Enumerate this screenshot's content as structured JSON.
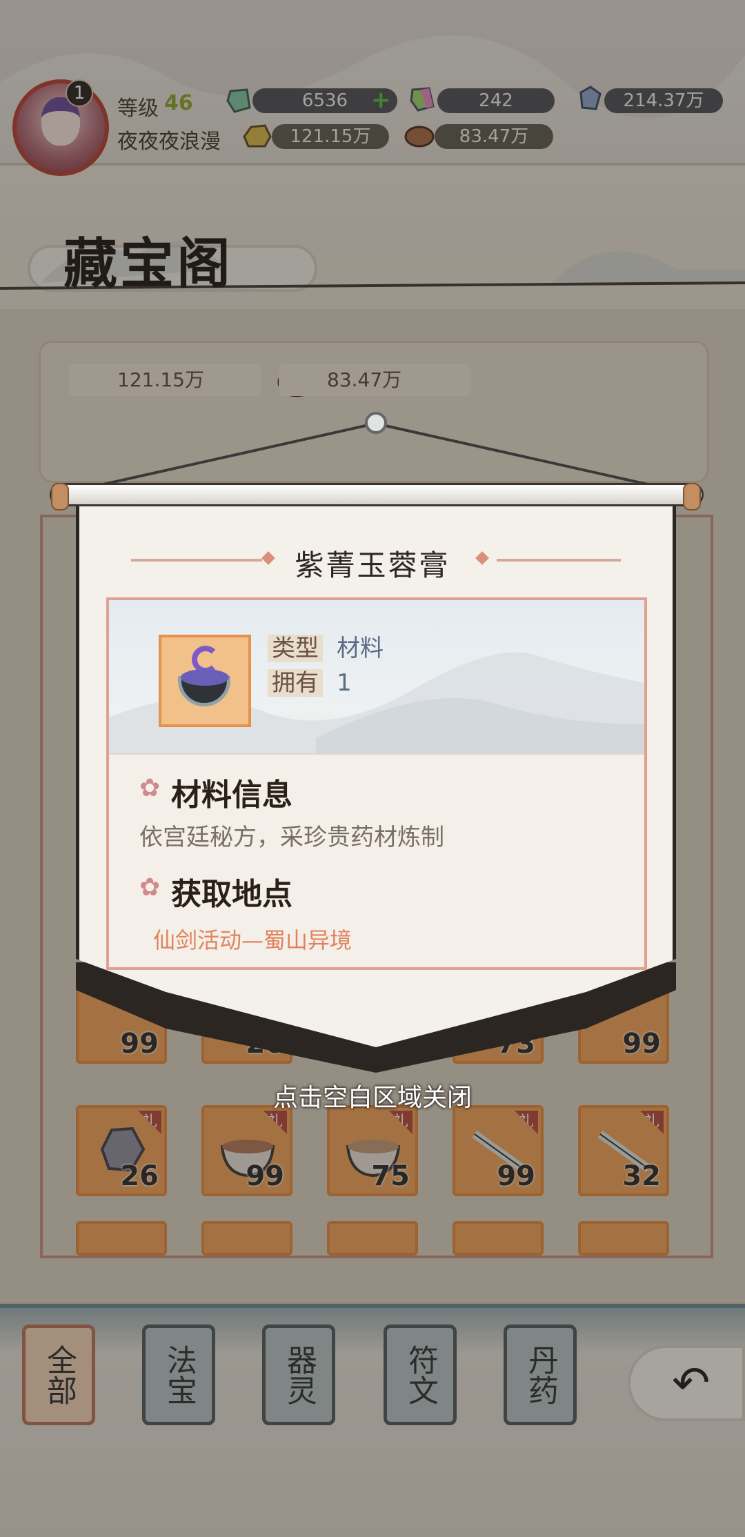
{
  "player": {
    "level_label": "等级",
    "level": "46",
    "name": "夜夜夜浪漫",
    "avatar_badge": "1"
  },
  "currencies": {
    "gem_green": "6536",
    "gem_rainbow": "242",
    "crystal": "214.37万",
    "gold_ore": "121.15万",
    "wood": "83.47万"
  },
  "header": {
    "title": "藏宝阁"
  },
  "panel_resources": {
    "gold_ore": "121.15万",
    "wood": "83.47万"
  },
  "grid": {
    "rows": [
      {
        "counts": [
          "99",
          "26",
          "",
          "73",
          "99"
        ]
      },
      {
        "counts": [
          "26",
          "99",
          "75",
          "99",
          "32"
        ]
      }
    ],
    "gift_tag": "礼"
  },
  "popup": {
    "item_name": "紫菁玉蓉膏",
    "type_label": "类型",
    "type_value": "材料",
    "own_label": "拥有",
    "own_value": "1",
    "info_heading": "材料信息",
    "info_text": "依宫廷秘方，采珍贵药材炼制",
    "source_heading": "获取地点",
    "source_text": "仙剑活动—蜀山异境",
    "close_hint": "点击空白区域关闭"
  },
  "tabs": [
    {
      "label": "全部",
      "active": true
    },
    {
      "label": "法宝",
      "active": false
    },
    {
      "label": "器灵",
      "active": false
    },
    {
      "label": "符文",
      "active": false
    },
    {
      "label": "丹药",
      "active": false
    }
  ],
  "icons": {
    "gem_green": "green-gem-icon",
    "gem_rainbow": "rainbow-gem-icon",
    "crystal": "blue-crystal-icon",
    "gold_ore": "gold-ore-icon",
    "wood": "wood-log-icon",
    "back": "back-arrow-icon",
    "plus": "plus-icon",
    "flower": "flower-icon"
  },
  "colors": {
    "accent_orange": "#e0835a",
    "cell_orange": "#f0a35a",
    "level_green": "#8aa52b"
  }
}
